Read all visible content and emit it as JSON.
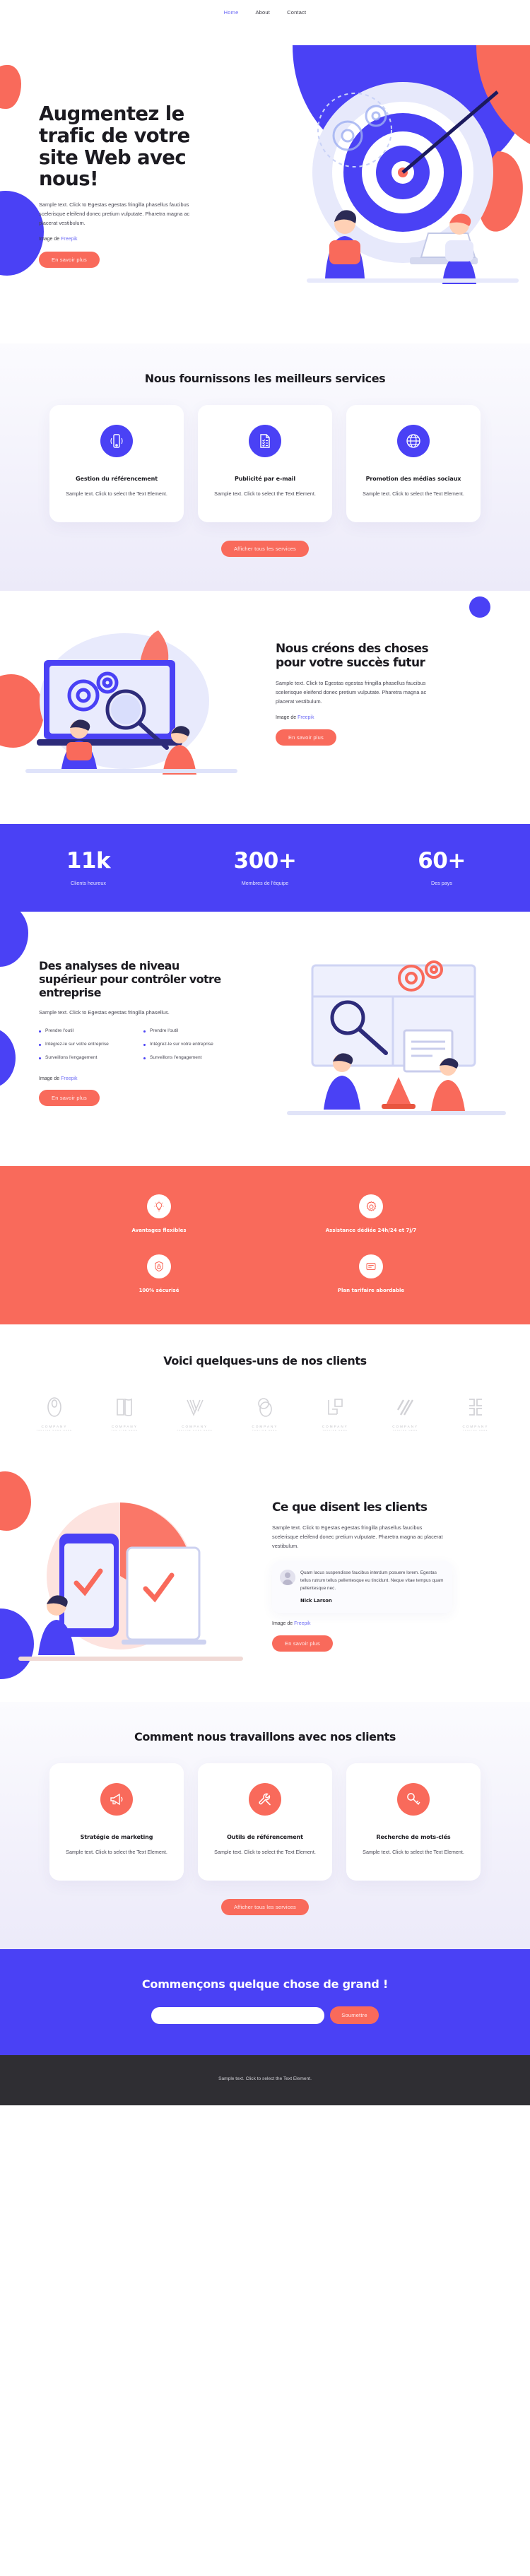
{
  "nav": {
    "items": [
      {
        "label": "Home",
        "active": true
      },
      {
        "label": "About",
        "active": false
      },
      {
        "label": "Contact",
        "active": false
      }
    ]
  },
  "hero": {
    "heading": "Augmentez le trafic de votre site Web avec nous!",
    "paragraph": "Sample text. Click to Egestas egestas fringilla phasellus faucibus scelerisque eleifend donec pretium vulputate. Pharetra magna ac placerat vestibulum.",
    "credit_prefix": "Image de ",
    "credit_link": "Freepik",
    "cta": "En savoir plus",
    "art_name": "target-dartboard-team-illustration"
  },
  "services": {
    "title": "Nous fournissons les meilleurs services",
    "cards": [
      {
        "icon": "mobile-phone-icon",
        "title": "Gestion du référencement",
        "text": "Sample text. Click to select the Text Element."
      },
      {
        "icon": "document-checklist-icon",
        "title": "Publicité par e-mail",
        "text": "Sample text. Click to select the Text Element."
      },
      {
        "icon": "globe-icon",
        "title": "Promotion des médias sociaux",
        "text": "Sample text. Click to select the Text Element."
      }
    ],
    "cta": "Afficher tous les services"
  },
  "create": {
    "heading": "Nous créons des choses pour votre succès futur",
    "paragraph": "Sample text. Click to Egestas egestas fringilla phasellus faucibus scelerisque eleifend donec pretium vulputate. Pharetra magna ac placerat vestibulum.",
    "credit_prefix": "Image de ",
    "credit_link": "Freepik",
    "cta": "En savoir plus",
    "art_name": "laptop-magnifier-gears-illustration"
  },
  "stats": [
    {
      "number": "11k",
      "label": "Clients heureux"
    },
    {
      "number": "300+",
      "label": "Membres de l'équipe"
    },
    {
      "number": "60+",
      "label": "Des pays"
    }
  ],
  "analytics": {
    "heading": "Des analyses de niveau supérieur pour contrôler votre entreprise",
    "paragraph": "Sample text. Click to Egestas egestas fringilla phasellus.",
    "bullets_left": [
      "Prendre l'outil",
      "Intégrez-le sur votre entreprise",
      "Surveillons l'engagement"
    ],
    "bullets_right": [
      "Prendre l'outil",
      "Intégrez-le sur votre entreprise",
      "Surveillons l'engagement"
    ],
    "credit_prefix": "Image de ",
    "credit_link": "Freepik",
    "cta": "En savoir plus",
    "art_name": "whiteboard-people-analytics-illustration"
  },
  "features": [
    {
      "icon": "lightbulb-icon",
      "label": "Avantages flexibles"
    },
    {
      "icon": "gear-icon",
      "label": "Assistance dédiée 24h/24 et 7j/7"
    },
    {
      "icon": "shield-lock-icon",
      "label": "100% sécurisé"
    },
    {
      "icon": "price-tag-icon",
      "label": "Plan tarifaire abordable"
    }
  ],
  "clients": {
    "title": "Voici quelques-uns de nos clients",
    "logos": [
      {
        "mark": "oval-loop-mark",
        "name": "COMPANY",
        "tagline": "TAGLINE GOES HERE"
      },
      {
        "mark": "folded-pages-mark",
        "name": "COMPANY",
        "tagline": "TAG LINE HERE"
      },
      {
        "mark": "chevron-lines-mark",
        "name": "COMPANY",
        "tagline": "TAGLINE GOES HERE"
      },
      {
        "mark": "overlapping-circles-mark",
        "name": "COMPANY",
        "tagline": "TAGLINE HERE"
      },
      {
        "mark": "squares-corner-mark",
        "name": "COMPANY",
        "tagline": "TAGLINE HERE"
      },
      {
        "mark": "diagonal-stripes-mark",
        "name": "COMPANY",
        "tagline": "TAGLINE HERE"
      },
      {
        "mark": "split-blocks-mark",
        "name": "COMPANY",
        "tagline": "TAGLINE HERE"
      }
    ]
  },
  "testimonials": {
    "heading": "Ce que disent les clients",
    "paragraph": "Sample text. Click to Egestas egestas fringilla phasellus faucibus scelerisque eleifend donec pretium vulputate. Pharetra magna ac placerat vestibulum.",
    "quote": "Quam lacus suspendisse faucibus interdum posuere lorem. Egestas tellus rutrum tellus pellentesque eu tincidunt. Neque vitae tempus quam pellentesque nec.",
    "author": "Nick Larson",
    "credit_prefix": "Image de ",
    "credit_link": "Freepik",
    "cta": "En savoir plus",
    "art_name": "devices-checkmark-illustration"
  },
  "process": {
    "title": "Comment nous travaillons avec nos clients",
    "cards": [
      {
        "icon": "megaphone-icon",
        "title": "Stratégie de marketing",
        "text": "Sample text. Click to select the Text Element."
      },
      {
        "icon": "wrench-tools-icon",
        "title": "Outils de référencement",
        "text": "Sample text. Click to select the Text Element."
      },
      {
        "icon": "key-icon",
        "title": "Recherche de mots-clés",
        "text": "Sample text. Click to select the Text Element."
      }
    ],
    "cta": "Afficher tous les services"
  },
  "cta_section": {
    "heading": "Commençons quelque chose de grand !",
    "input_value": "",
    "input_placeholder": "",
    "submit_label": "Soumettre"
  },
  "footer": {
    "text": "Sample text. Click to select the Text Element."
  },
  "colors": {
    "blue": "#4a41f5",
    "coral": "#f96a5b",
    "dark": "#2f2e33",
    "lilac_bg": "#eceaf9"
  }
}
